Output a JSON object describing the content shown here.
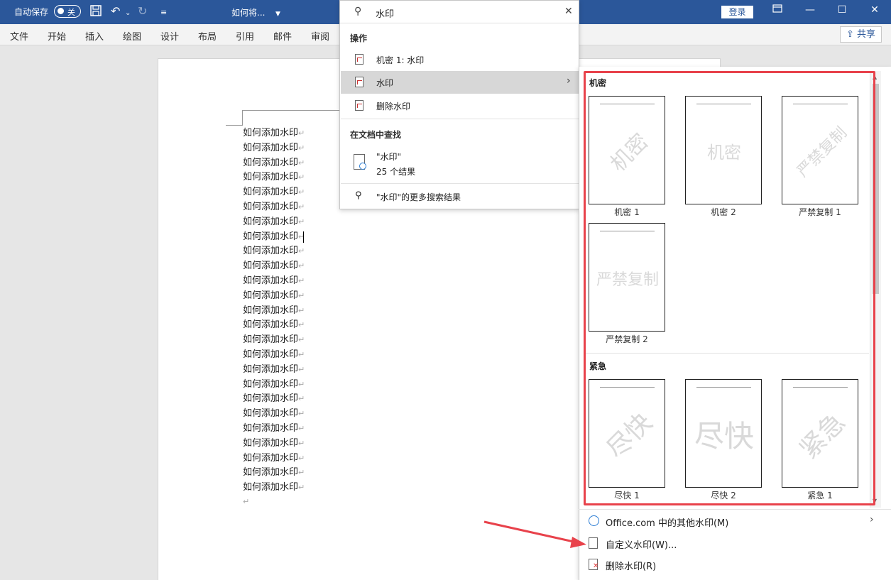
{
  "titlebar": {
    "autosave_label": "自动保存",
    "autosave_state": "关",
    "doc_title": "如何将...",
    "login_label": "登录"
  },
  "ribbon": {
    "tabs": [
      "文件",
      "开始",
      "插入",
      "绘图",
      "设计",
      "布局",
      "引用",
      "邮件",
      "审阅"
    ],
    "share_label": "共享"
  },
  "document": {
    "line_text": "如何添加水印",
    "line_count": 25
  },
  "search": {
    "query": "水印",
    "actions_heading": "操作",
    "actions": [
      {
        "label": "机密 1: 水印",
        "active": false
      },
      {
        "label": "水印",
        "active": true
      },
      {
        "label": "删除水印",
        "active": false
      }
    ],
    "find_heading": "在文档中查找",
    "find_query": "\"水印\"",
    "find_results": "25 个结果",
    "more_results": "\"水印\"的更多搜索结果"
  },
  "gallery": {
    "section1": "机密",
    "section2": "紧急",
    "watermarks": [
      {
        "caption": "机密 1",
        "text": "机密"
      },
      {
        "caption": "机密 2",
        "text": "机密"
      },
      {
        "caption": "严禁复制 1",
        "text": "严禁复制"
      },
      {
        "caption": "严禁复制 2",
        "text": "严禁复制"
      },
      {
        "caption": "尽快 1",
        "text": "尽快"
      },
      {
        "caption": "尽快 2",
        "text": "尽快"
      },
      {
        "caption": "紧急 1",
        "text": "紧急"
      }
    ]
  },
  "menu": {
    "more_online": "Office.com 中的其他水印(M)",
    "custom": "自定义水印(W)...",
    "remove": "删除水印(R)"
  },
  "colors": {
    "title_bar": "#2b579a",
    "highlight": "#e8424b",
    "arrow": "#e8424b"
  }
}
